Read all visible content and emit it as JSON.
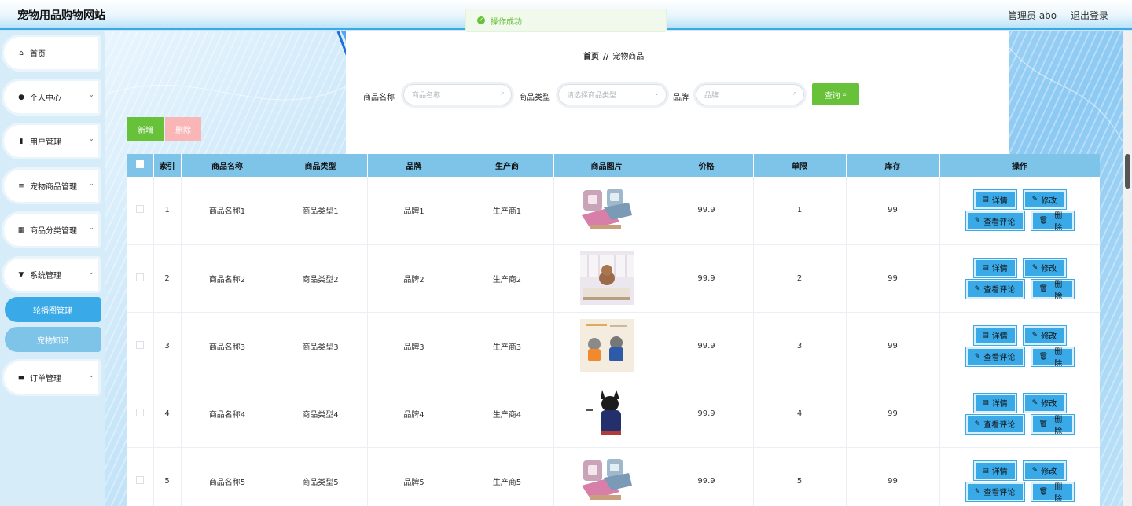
{
  "header": {
    "site_title": "宠物用品购物网站",
    "user_label": "管理员 abo",
    "logout": "退出登录"
  },
  "toast": {
    "message": "操作成功"
  },
  "sidebar": {
    "items": [
      {
        "label": "首页",
        "icon": "home-icon",
        "has_chevron": false
      },
      {
        "label": "个人中心",
        "icon": "user-icon",
        "has_chevron": true
      },
      {
        "label": "用户管理",
        "icon": "bar-chart-icon",
        "has_chevron": true
      },
      {
        "label": "宠物商品管理",
        "icon": "menu-icon",
        "has_chevron": true
      },
      {
        "label": "商品分类管理",
        "icon": "grid-icon",
        "has_chevron": true
      },
      {
        "label": "系统管理",
        "icon": "pin-icon",
        "has_chevron": true
      },
      {
        "label": "订单管理",
        "icon": "chat-icon",
        "has_chevron": true
      }
    ],
    "subitems": [
      {
        "label": "轮播图管理",
        "state": "hover"
      },
      {
        "label": "宠物知识",
        "state": "normal"
      }
    ]
  },
  "breadcrumb": {
    "home": "首页",
    "separator": "//",
    "current": "宠物商品"
  },
  "search": {
    "name_label": "商品名称",
    "name_placeholder": "商品名称",
    "type_label": "商品类型",
    "type_placeholder": "请选择商品类型",
    "brand_label": "品牌",
    "brand_placeholder": "品牌",
    "query_button": "查询"
  },
  "actions": {
    "add": "新增",
    "delete": "删除"
  },
  "table": {
    "columns": [
      "索引",
      "商品名称",
      "商品类型",
      "品牌",
      "生产商",
      "商品图片",
      "价格",
      "单限",
      "库存",
      "操作"
    ],
    "rows": [
      {
        "index": "1",
        "name": "商品名称1",
        "type": "商品类型1",
        "brand": "品牌1",
        "maker": "生产商1",
        "price": "99.9",
        "limit": "1",
        "stock": "99",
        "image": "pet-bed-image"
      },
      {
        "index": "2",
        "name": "商品名称2",
        "type": "商品类型2",
        "brand": "品牌2",
        "maker": "生产商2",
        "price": "99.9",
        "limit": "2",
        "stock": "99",
        "image": "dog-on-bed-image"
      },
      {
        "index": "3",
        "name": "商品名称3",
        "type": "商品类型3",
        "brand": "品牌3",
        "maker": "生产商3",
        "price": "99.9",
        "limit": "3",
        "stock": "99",
        "image": "dogs-in-clothes-image"
      },
      {
        "index": "4",
        "name": "商品名称4",
        "type": "商品类型4",
        "brand": "品牌4",
        "maker": "生产商4",
        "price": "99.9",
        "limit": "4",
        "stock": "99",
        "image": "black-dog-image"
      },
      {
        "index": "5",
        "name": "商品名称5",
        "type": "商品类型5",
        "brand": "品牌5",
        "maker": "生产商5",
        "price": "99.9",
        "limit": "5",
        "stock": "99",
        "image": "pet-bed-image"
      }
    ],
    "row_buttons": {
      "detail": "详情",
      "edit": "修改",
      "comments": "查看评论",
      "delete": "删除"
    }
  },
  "colors": {
    "accent_green": "#67c23a",
    "header_blue": "#7ec4e9",
    "button_blue": "#3aa9e8",
    "danger_light": "#fab6b6"
  }
}
